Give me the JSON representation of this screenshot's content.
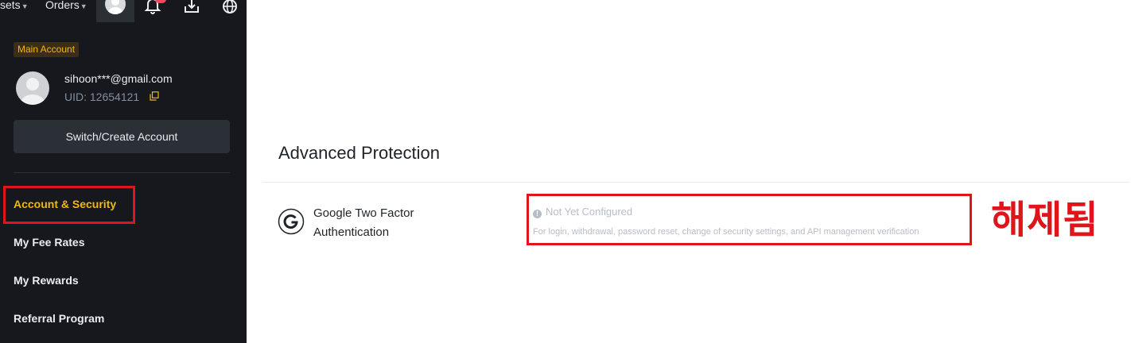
{
  "topnav": {
    "assets_label": "sets",
    "orders_label": "Orders"
  },
  "account": {
    "badge": "Main Account",
    "email": "sihoon***@gmail.com",
    "uid": "UID: 12654121",
    "switch_label": "Switch/Create Account"
  },
  "sidebar": {
    "items": [
      {
        "label": "Account & Security",
        "active": true
      },
      {
        "label": "My Fee Rates",
        "active": false
      },
      {
        "label": "My Rewards",
        "active": false
      },
      {
        "label": "Referral Program",
        "active": false
      }
    ]
  },
  "main": {
    "section_title": "Advanced Protection",
    "feature": {
      "icon": "google-icon",
      "name": "Google Two Factor Authentication",
      "status": "Not Yet Configured",
      "description": "For login, withdrawal, password reset, change of security settings, and API management verification"
    },
    "annotation": "해제됨"
  },
  "colors": {
    "sidebar_bg": "#16181d",
    "accent": "#f0b90b",
    "highlight": "#e0151b",
    "muted": "#b7bdc6"
  }
}
